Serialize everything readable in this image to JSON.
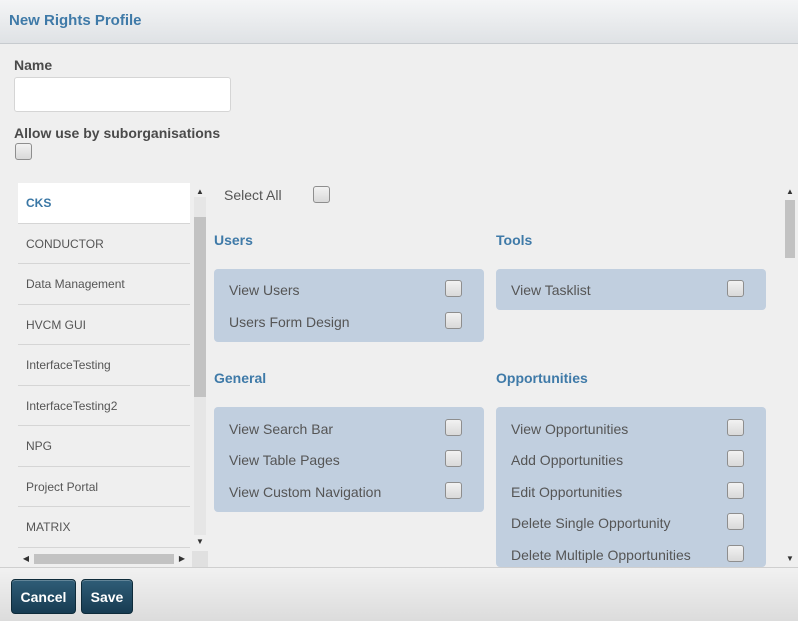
{
  "dialog": {
    "title": "New Rights Profile"
  },
  "form": {
    "name_label": "Name",
    "name_value": "",
    "suborg_label": "Allow use by suborganisations"
  },
  "organisations": [
    "CKS",
    "CONDUCTOR",
    "Data Management",
    "HVCM GUI",
    "InterfaceTesting",
    "InterfaceTesting2",
    "NPG",
    "Project Portal",
    "MATRIX"
  ],
  "selected_organisation": "CKS",
  "select_all_label": "Select All",
  "sections": {
    "users": {
      "title": "Users",
      "items": [
        "View Users",
        "Users Form Design"
      ]
    },
    "tools": {
      "title": "Tools",
      "items": [
        "View Tasklist"
      ]
    },
    "general": {
      "title": "General",
      "items": [
        "View Search Bar",
        "View Table Pages",
        "View Custom Navigation"
      ]
    },
    "opportunities": {
      "title": "Opportunities",
      "items": [
        "View Opportunities",
        "Add Opportunities",
        "Edit Opportunities",
        "Delete Single Opportunity",
        "Delete Multiple Opportunities"
      ]
    }
  },
  "footer": {
    "cancel_label": "Cancel",
    "save_label": "Save"
  }
}
